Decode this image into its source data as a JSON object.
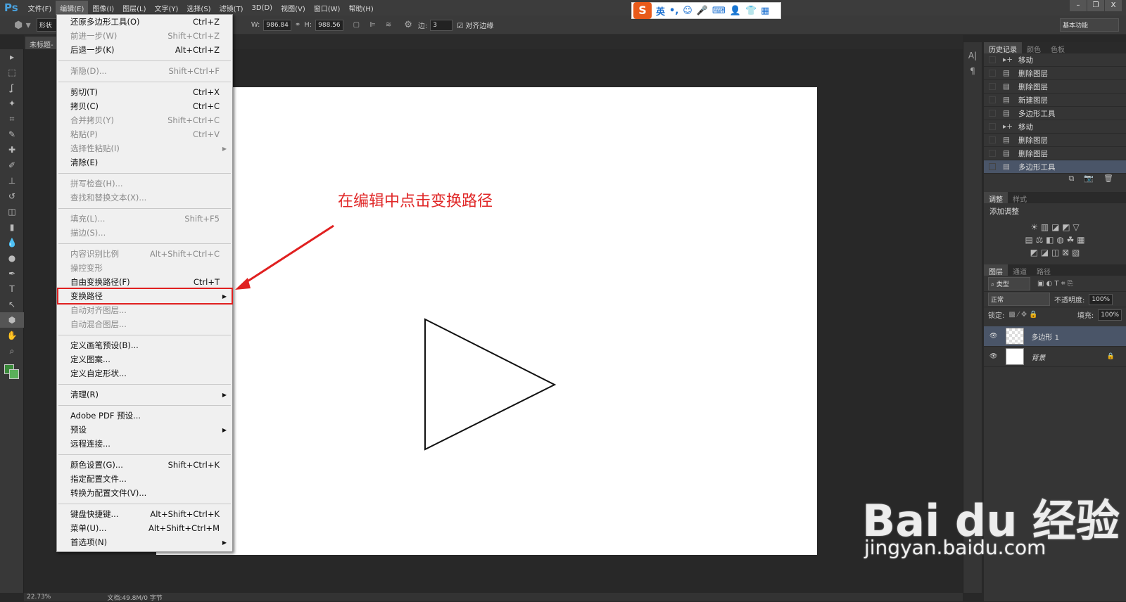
{
  "app": {
    "logo": "Ps"
  },
  "menubar": [
    "文件(F)",
    "编辑(E)",
    "图像(I)",
    "图层(L)",
    "文字(Y)",
    "选择(S)",
    "滤镜(T)",
    "3D(D)",
    "视图(V)",
    "窗口(W)",
    "帮助(H)"
  ],
  "window_buttons": [
    "–",
    "❐",
    "X"
  ],
  "ime": {
    "logo": "S",
    "items": [
      "英",
      "•,",
      "☺",
      "🎤",
      "⌨",
      "👤",
      "👕",
      "▦"
    ]
  },
  "options": {
    "mode": "形状",
    "w_label": "W:",
    "w": "986.84",
    "h_label": "H:",
    "h": "988.56",
    "sides_label": "边:",
    "sides": "3",
    "align_label": "对齐边缘",
    "workspace": "基本功能"
  },
  "document": {
    "tab": "未标题-"
  },
  "edit_menu": [
    {
      "label": "还原多边形工具(O)",
      "shortcut": "Ctrl+Z"
    },
    {
      "label": "前进一步(W)",
      "shortcut": "Shift+Ctrl+Z",
      "disabled": true
    },
    {
      "label": "后退一步(K)",
      "shortcut": "Alt+Ctrl+Z"
    },
    {
      "sep": true
    },
    {
      "label": "渐隐(D)...",
      "shortcut": "Shift+Ctrl+F",
      "disabled": true
    },
    {
      "sep": true
    },
    {
      "label": "剪切(T)",
      "shortcut": "Ctrl+X"
    },
    {
      "label": "拷贝(C)",
      "shortcut": "Ctrl+C"
    },
    {
      "label": "合并拷贝(Y)",
      "shortcut": "Shift+Ctrl+C",
      "disabled": true
    },
    {
      "label": "粘贴(P)",
      "shortcut": "Ctrl+V",
      "disabled": true
    },
    {
      "label": "选择性粘贴(I)",
      "shortcut": "",
      "disabled": true,
      "submenu": true
    },
    {
      "label": "清除(E)",
      "shortcut": ""
    },
    {
      "sep": true
    },
    {
      "label": "拼写检查(H)...",
      "shortcut": "",
      "disabled": true
    },
    {
      "label": "查找和替换文本(X)...",
      "shortcut": "",
      "disabled": true
    },
    {
      "sep": true
    },
    {
      "label": "填充(L)...",
      "shortcut": "Shift+F5",
      "disabled": true
    },
    {
      "label": "描边(S)...",
      "shortcut": "",
      "disabled": true
    },
    {
      "sep": true
    },
    {
      "label": "内容识别比例",
      "shortcut": "Alt+Shift+Ctrl+C",
      "disabled": true
    },
    {
      "label": "操控变形",
      "shortcut": "",
      "disabled": true
    },
    {
      "label": "自由变换路径(F)",
      "shortcut": "Ctrl+T"
    },
    {
      "label": "变换路径",
      "shortcut": "",
      "submenu": true
    },
    {
      "label": "自动对齐图层...",
      "shortcut": "",
      "disabled": true
    },
    {
      "label": "自动混合图层...",
      "shortcut": "",
      "disabled": true
    },
    {
      "sep": true
    },
    {
      "label": "定义画笔预设(B)...",
      "shortcut": ""
    },
    {
      "label": "定义图案...",
      "shortcut": ""
    },
    {
      "label": "定义自定形状...",
      "shortcut": ""
    },
    {
      "sep": true
    },
    {
      "label": "清理(R)",
      "shortcut": "",
      "submenu": true
    },
    {
      "sep": true
    },
    {
      "label": "Adobe PDF 预设...",
      "shortcut": ""
    },
    {
      "label": "预设",
      "shortcut": "",
      "submenu": true
    },
    {
      "label": "远程连接...",
      "shortcut": ""
    },
    {
      "sep": true
    },
    {
      "label": "颜色设置(G)...",
      "shortcut": "Shift+Ctrl+K"
    },
    {
      "label": "指定配置文件...",
      "shortcut": ""
    },
    {
      "label": "转换为配置文件(V)...",
      "shortcut": ""
    },
    {
      "sep": true
    },
    {
      "label": "键盘快捷键...",
      "shortcut": "Alt+Shift+Ctrl+K"
    },
    {
      "label": "菜单(U)...",
      "shortcut": "Alt+Shift+Ctrl+M"
    },
    {
      "label": "首选项(N)",
      "shortcut": "",
      "submenu": true
    }
  ],
  "annotation": "在编辑中点击变换路径",
  "history": {
    "tabs": [
      "历史记录",
      "颜色",
      "色板"
    ],
    "items": [
      {
        "label": "移动",
        "icon": "move"
      },
      {
        "label": "删除图层",
        "icon": "doc"
      },
      {
        "label": "删除图层",
        "icon": "doc"
      },
      {
        "label": "新建图层",
        "icon": "doc"
      },
      {
        "label": "多边形工具",
        "icon": "doc"
      },
      {
        "label": "移动",
        "icon": "move"
      },
      {
        "label": "删除图层",
        "icon": "doc"
      },
      {
        "label": "删除图层",
        "icon": "doc"
      },
      {
        "label": "多边形工具",
        "icon": "doc",
        "selected": true
      }
    ]
  },
  "adjust": {
    "tabs": [
      "调整",
      "样式"
    ],
    "title": "添加调整"
  },
  "layers": {
    "tabs": [
      "图层",
      "通道",
      "路径"
    ],
    "filter": "类型",
    "blend": "正常",
    "opacity_label": "不透明度:",
    "opacity": "100%",
    "lock_label": "锁定:",
    "fill_label": "填充:",
    "fill": "100%",
    "items": [
      {
        "name": "多边形 1",
        "selected": true
      },
      {
        "name": "背景",
        "locked": true
      }
    ]
  },
  "status": {
    "zoom": "22.73%",
    "doc": "文档:49.8M/0 字节"
  },
  "watermark": {
    "brand": "Bai du 经验",
    "url": "jingyan.baidu.com"
  }
}
